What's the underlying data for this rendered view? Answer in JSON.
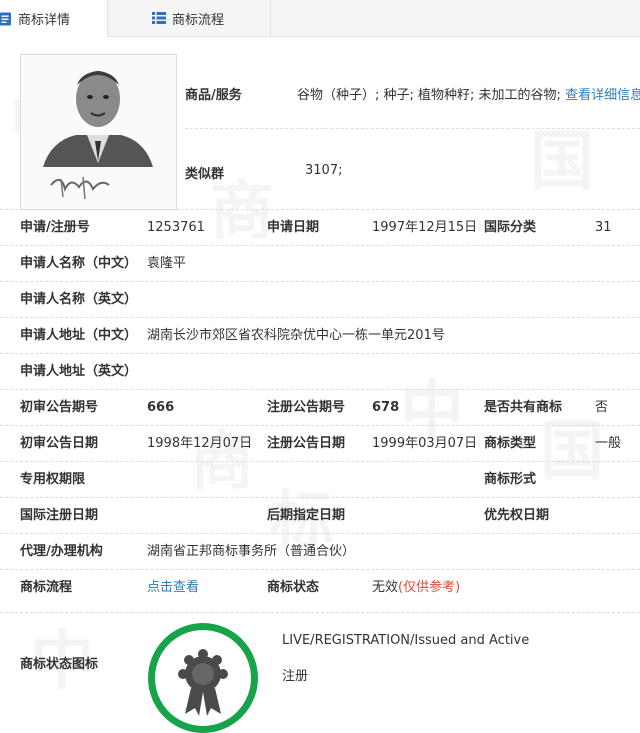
{
  "tabs": [
    {
      "label": "商标详情",
      "icon": "document-icon"
    },
    {
      "label": "商标流程",
      "icon": "list-icon"
    }
  ],
  "goods": {
    "label": "商品/服务",
    "value": "谷物（种子）; 种子; 植物种籽; 未加工的谷物;",
    "link": "查看详细信息"
  },
  "similar_group": {
    "label": "类似群",
    "value": "3107;"
  },
  "fields": {
    "reg_no": {
      "label": "申请/注册号",
      "value": "1253761"
    },
    "apply_date": {
      "label": "申请日期",
      "value": "1997年12月15日"
    },
    "intl_class": {
      "label": "国际分类",
      "value": "31"
    },
    "applicant_cn": {
      "label": "申请人名称（中文）",
      "value": "袁隆平"
    },
    "applicant_en": {
      "label": "申请人名称（英文）",
      "value": ""
    },
    "address_cn": {
      "label": "申请人地址（中文）",
      "value": "湖南长沙市郊区省农科院杂优中心一栋一单元201号"
    },
    "address_en": {
      "label": "申请人地址（英文）",
      "value": ""
    },
    "prelim_no": {
      "label": "初审公告期号",
      "value": "666"
    },
    "reg_notice_no": {
      "label": "注册公告期号",
      "value": "678"
    },
    "shared": {
      "label": "是否共有商标",
      "value": "否"
    },
    "prelim_date": {
      "label": "初审公告日期",
      "value": "1998年12月07日"
    },
    "reg_notice_date": {
      "label": "注册公告日期",
      "value": "1999年03月07日"
    },
    "mark_type": {
      "label": "商标类型",
      "value": "一般"
    },
    "exclusive_period": {
      "label": "专用权期限",
      "value": ""
    },
    "mark_form": {
      "label": "商标形式",
      "value": ""
    },
    "intl_reg_date": {
      "label": "国际注册日期",
      "value": ""
    },
    "later_date": {
      "label": "后期指定日期",
      "value": ""
    },
    "priority_date": {
      "label": "优先权日期",
      "value": ""
    },
    "agency": {
      "label": "代理/办理机构",
      "value": "湖南省正邦商标事务所（普通合伙）"
    },
    "process": {
      "label": "商标流程",
      "value": "点击查看"
    },
    "status": {
      "label": "商标状态",
      "value": "无效",
      "note": "(仅供参考)"
    },
    "status_icon": {
      "label": "商标状态图标",
      "text_en": "LIVE/REGISTRATION/Issued and Active",
      "text_cn": "注册"
    }
  },
  "colors": {
    "link": "#2e7db6",
    "note": "#e24b2b",
    "badge_ring": "#16a34a"
  }
}
